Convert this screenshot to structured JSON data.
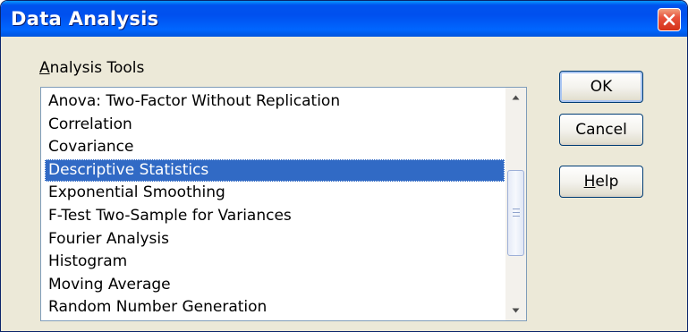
{
  "window": {
    "title": "Data Analysis"
  },
  "analysis_tools": {
    "label_mnemonic": "A",
    "label_rest": "nalysis Tools",
    "items": [
      "Anova: Two-Factor Without Replication",
      "Correlation",
      "Covariance",
      "Descriptive Statistics",
      "Exponential Smoothing",
      "F-Test Two-Sample for Variances",
      "Fourier Analysis",
      "Histogram",
      "Moving Average",
      "Random Number Generation"
    ],
    "selected": "Descriptive Statistics"
  },
  "buttons": {
    "ok": "OK",
    "cancel": "Cancel",
    "help_mnemonic": "H",
    "help_rest": "elp"
  },
  "icons": {
    "close": "close-icon",
    "scroll_up": "scroll-up-arrow-icon",
    "scroll_down": "scroll-down-arrow-icon"
  },
  "colors": {
    "titlebar": "#0055e5",
    "selection": "#316ac5",
    "close_button": "#e0502f",
    "dialog_face": "#ece9d8"
  }
}
